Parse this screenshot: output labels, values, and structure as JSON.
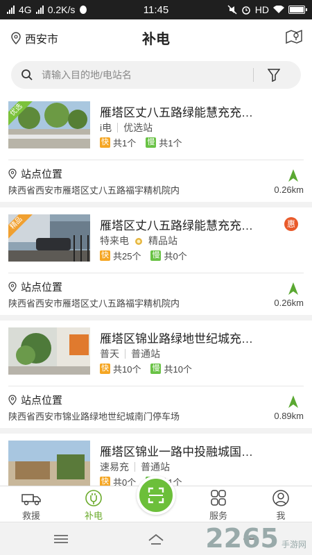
{
  "status_bar": {
    "left_text": "4G",
    "speed": "0.2K/s",
    "time": "11:45",
    "hd": "HD"
  },
  "app_bar": {
    "city": "西安市",
    "title": "补电"
  },
  "search": {
    "placeholder": "请输入目的地/电站名"
  },
  "location_label": "站点位置",
  "stations": [
    {
      "name": "雁塔区丈八五路绿能慧充充…",
      "ribbon": "优选",
      "operator": "i电",
      "level": "优选站",
      "fast": "共1个",
      "slow": "共1个",
      "address": "陕西省西安市雁塔区丈八五路福宇精机院内",
      "distance": "0.26km"
    },
    {
      "name": "雁塔区丈八五路绿能慧充充…",
      "ribbon": "精品",
      "badge": "惠",
      "operator": "特来电",
      "level": "精品站",
      "fast": "共25个",
      "slow": "共0个",
      "address": "陕西省西安市雁塔区丈八五路福宇精机院内",
      "distance": "0.26km"
    },
    {
      "name": "雁塔区锦业路绿地世纪城充…",
      "operator": "普天",
      "level": "普通站",
      "fast": "共10个",
      "slow": "共10个",
      "address": "陕西省西安市锦业路绿地世纪城南门停车场",
      "distance": "0.89km"
    },
    {
      "name": "雁塔区锦业一路中投融城国…",
      "operator": "速易充",
      "level": "普通站",
      "fast": "共0个",
      "slow": "共1个"
    }
  ],
  "tags": {
    "fast": "快",
    "slow": "慢"
  },
  "tabs": {
    "rescue": "救援",
    "charge": "补电",
    "service": "服务",
    "me": "我"
  },
  "watermark": {
    "number": "2265",
    "text": "手游网"
  },
  "colors": {
    "accent": "#6aaa2a",
    "fast": "#f5a623",
    "slow": "#69c245",
    "deal": "#e95a2a"
  }
}
